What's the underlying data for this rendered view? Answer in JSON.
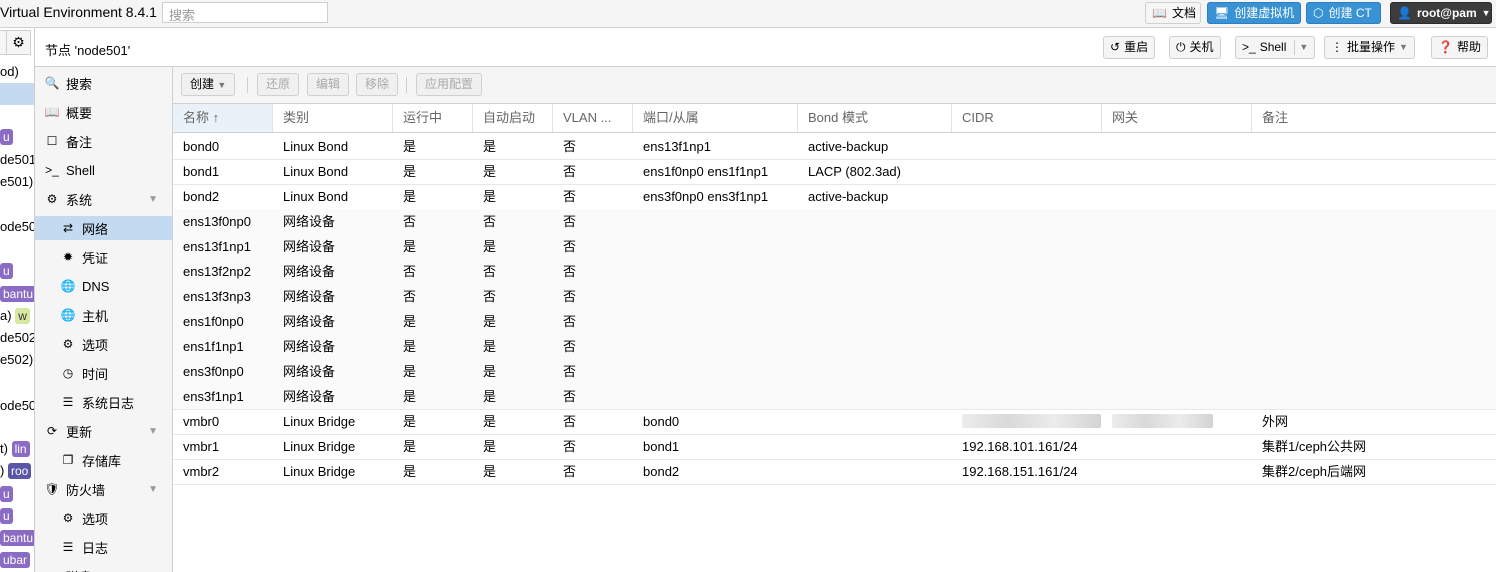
{
  "topbar": {
    "title": "Virtual Environment 8.4.1",
    "search_placeholder": "搜索",
    "docs": "文档",
    "create_vm": "创建虚拟机",
    "create_ct": "创建 CT",
    "user": "root@pam"
  },
  "tree": {
    "items": [
      "od)",
      "u",
      "de501",
      "e501)",
      "ode50",
      "u",
      "bantu",
      "a)",
      "w",
      "de502",
      "e502)",
      "ode50",
      "t)",
      "lin",
      ")",
      "roo",
      "u",
      "u",
      "bantu",
      "ubar"
    ]
  },
  "header": {
    "node_title": "节点 'node501'",
    "reboot": "重启",
    "shutdown": "关机",
    "shell": "Shell",
    "bulk": "批量操作",
    "help": "帮助"
  },
  "menu": {
    "items": [
      {
        "label": "搜索",
        "icon": "search-icon"
      },
      {
        "label": "概要",
        "icon": "book-icon"
      },
      {
        "label": "备注",
        "icon": "note-icon"
      },
      {
        "label": "Shell",
        "icon": "terminal-icon"
      },
      {
        "label": "系统",
        "icon": "cogs-icon"
      },
      {
        "label": "网络",
        "icon": "exchange-icon"
      },
      {
        "label": "凭证",
        "icon": "certificate-icon"
      },
      {
        "label": "DNS",
        "icon": "globe-icon"
      },
      {
        "label": "主机",
        "icon": "globe-icon"
      },
      {
        "label": "选项",
        "icon": "gear-icon"
      },
      {
        "label": "时间",
        "icon": "clock-icon"
      },
      {
        "label": "系统日志",
        "icon": "list-icon"
      },
      {
        "label": "更新",
        "icon": "refresh-icon"
      },
      {
        "label": "存储库",
        "icon": "files-icon"
      },
      {
        "label": "防火墙",
        "icon": "shield-icon"
      },
      {
        "label": "选项",
        "icon": "gear-icon"
      },
      {
        "label": "日志",
        "icon": "list-icon"
      },
      {
        "label": "磁盘",
        "icon": "disk-icon"
      }
    ]
  },
  "toolbar": {
    "create": "创建",
    "revert": "还原",
    "edit": "编辑",
    "remove": "移除",
    "apply": "应用配置"
  },
  "table": {
    "columns": [
      "名称 ↑",
      "类别",
      "运行中",
      "自动启动",
      "VLAN ...",
      "端口/从属",
      "Bond 模式",
      "CIDR",
      "网关",
      "备注"
    ],
    "rows": [
      [
        "bond0",
        "Linux Bond",
        "是",
        "是",
        "否",
        "ens13f1np1",
        "active-backup",
        "",
        "",
        ""
      ],
      [
        "bond1",
        "Linux Bond",
        "是",
        "是",
        "否",
        "ens1f0np0 ens1f1np1",
        "LACP (802.3ad)",
        "",
        "",
        ""
      ],
      [
        "bond2",
        "Linux Bond",
        "是",
        "是",
        "否",
        "ens3f0np0 ens3f1np1",
        "active-backup",
        "",
        "",
        ""
      ],
      [
        "ens13f0np0",
        "网络设备",
        "否",
        "否",
        "否",
        "",
        "",
        "",
        "",
        ""
      ],
      [
        "ens13f1np1",
        "网络设备",
        "是",
        "是",
        "否",
        "",
        "",
        "",
        "",
        ""
      ],
      [
        "ens13f2np2",
        "网络设备",
        "否",
        "否",
        "否",
        "",
        "",
        "",
        "",
        ""
      ],
      [
        "ens13f3np3",
        "网络设备",
        "否",
        "否",
        "否",
        "",
        "",
        "",
        "",
        ""
      ],
      [
        "ens1f0np0",
        "网络设备",
        "是",
        "是",
        "否",
        "",
        "",
        "",
        "",
        ""
      ],
      [
        "ens1f1np1",
        "网络设备",
        "是",
        "是",
        "否",
        "",
        "",
        "",
        "",
        ""
      ],
      [
        "ens3f0np0",
        "网络设备",
        "是",
        "是",
        "否",
        "",
        "",
        "",
        "",
        ""
      ],
      [
        "ens3f1np1",
        "网络设备",
        "是",
        "是",
        "否",
        "",
        "",
        "",
        "",
        ""
      ],
      [
        "vmbr0",
        "Linux Bridge",
        "是",
        "是",
        "否",
        "bond0",
        "",
        "███.███.███.███/24",
        "███████████",
        "外网"
      ],
      [
        "vmbr1",
        "Linux Bridge",
        "是",
        "是",
        "否",
        "bond1",
        "",
        "192.168.101.161/24",
        "",
        "集群1/ceph公共网"
      ],
      [
        "vmbr2",
        "Linux Bridge",
        "是",
        "是",
        "否",
        "bond2",
        "",
        "192.168.151.161/24",
        "",
        "集群2/ceph后端网"
      ]
    ]
  }
}
